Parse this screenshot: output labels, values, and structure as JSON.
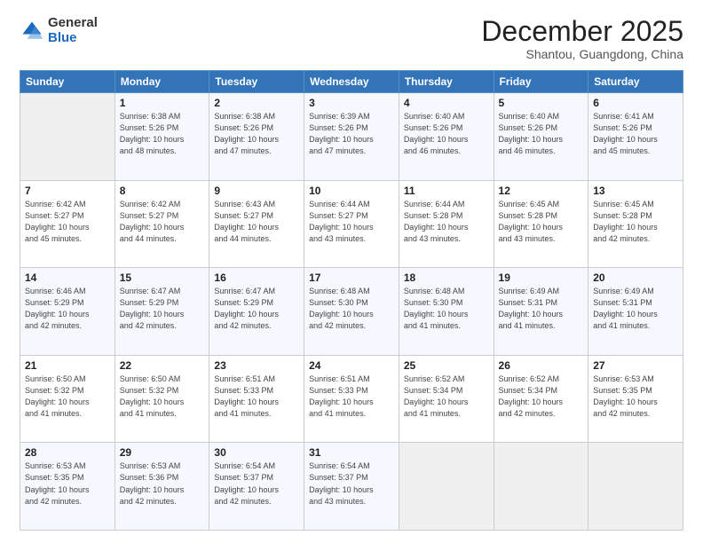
{
  "logo": {
    "general": "General",
    "blue": "Blue"
  },
  "header": {
    "month": "December 2025",
    "location": "Shantou, Guangdong, China"
  },
  "weekdays": [
    "Sunday",
    "Monday",
    "Tuesday",
    "Wednesday",
    "Thursday",
    "Friday",
    "Saturday"
  ],
  "weeks": [
    [
      {
        "day": "",
        "info": ""
      },
      {
        "day": "1",
        "info": "Sunrise: 6:38 AM\nSunset: 5:26 PM\nDaylight: 10 hours\nand 48 minutes."
      },
      {
        "day": "2",
        "info": "Sunrise: 6:38 AM\nSunset: 5:26 PM\nDaylight: 10 hours\nand 47 minutes."
      },
      {
        "day": "3",
        "info": "Sunrise: 6:39 AM\nSunset: 5:26 PM\nDaylight: 10 hours\nand 47 minutes."
      },
      {
        "day": "4",
        "info": "Sunrise: 6:40 AM\nSunset: 5:26 PM\nDaylight: 10 hours\nand 46 minutes."
      },
      {
        "day": "5",
        "info": "Sunrise: 6:40 AM\nSunset: 5:26 PM\nDaylight: 10 hours\nand 46 minutes."
      },
      {
        "day": "6",
        "info": "Sunrise: 6:41 AM\nSunset: 5:26 PM\nDaylight: 10 hours\nand 45 minutes."
      }
    ],
    [
      {
        "day": "7",
        "info": "Sunrise: 6:42 AM\nSunset: 5:27 PM\nDaylight: 10 hours\nand 45 minutes."
      },
      {
        "day": "8",
        "info": "Sunrise: 6:42 AM\nSunset: 5:27 PM\nDaylight: 10 hours\nand 44 minutes."
      },
      {
        "day": "9",
        "info": "Sunrise: 6:43 AM\nSunset: 5:27 PM\nDaylight: 10 hours\nand 44 minutes."
      },
      {
        "day": "10",
        "info": "Sunrise: 6:44 AM\nSunset: 5:27 PM\nDaylight: 10 hours\nand 43 minutes."
      },
      {
        "day": "11",
        "info": "Sunrise: 6:44 AM\nSunset: 5:28 PM\nDaylight: 10 hours\nand 43 minutes."
      },
      {
        "day": "12",
        "info": "Sunrise: 6:45 AM\nSunset: 5:28 PM\nDaylight: 10 hours\nand 43 minutes."
      },
      {
        "day": "13",
        "info": "Sunrise: 6:45 AM\nSunset: 5:28 PM\nDaylight: 10 hours\nand 42 minutes."
      }
    ],
    [
      {
        "day": "14",
        "info": "Sunrise: 6:46 AM\nSunset: 5:29 PM\nDaylight: 10 hours\nand 42 minutes."
      },
      {
        "day": "15",
        "info": "Sunrise: 6:47 AM\nSunset: 5:29 PM\nDaylight: 10 hours\nand 42 minutes."
      },
      {
        "day": "16",
        "info": "Sunrise: 6:47 AM\nSunset: 5:29 PM\nDaylight: 10 hours\nand 42 minutes."
      },
      {
        "day": "17",
        "info": "Sunrise: 6:48 AM\nSunset: 5:30 PM\nDaylight: 10 hours\nand 42 minutes."
      },
      {
        "day": "18",
        "info": "Sunrise: 6:48 AM\nSunset: 5:30 PM\nDaylight: 10 hours\nand 41 minutes."
      },
      {
        "day": "19",
        "info": "Sunrise: 6:49 AM\nSunset: 5:31 PM\nDaylight: 10 hours\nand 41 minutes."
      },
      {
        "day": "20",
        "info": "Sunrise: 6:49 AM\nSunset: 5:31 PM\nDaylight: 10 hours\nand 41 minutes."
      }
    ],
    [
      {
        "day": "21",
        "info": "Sunrise: 6:50 AM\nSunset: 5:32 PM\nDaylight: 10 hours\nand 41 minutes."
      },
      {
        "day": "22",
        "info": "Sunrise: 6:50 AM\nSunset: 5:32 PM\nDaylight: 10 hours\nand 41 minutes."
      },
      {
        "day": "23",
        "info": "Sunrise: 6:51 AM\nSunset: 5:33 PM\nDaylight: 10 hours\nand 41 minutes."
      },
      {
        "day": "24",
        "info": "Sunrise: 6:51 AM\nSunset: 5:33 PM\nDaylight: 10 hours\nand 41 minutes."
      },
      {
        "day": "25",
        "info": "Sunrise: 6:52 AM\nSunset: 5:34 PM\nDaylight: 10 hours\nand 41 minutes."
      },
      {
        "day": "26",
        "info": "Sunrise: 6:52 AM\nSunset: 5:34 PM\nDaylight: 10 hours\nand 42 minutes."
      },
      {
        "day": "27",
        "info": "Sunrise: 6:53 AM\nSunset: 5:35 PM\nDaylight: 10 hours\nand 42 minutes."
      }
    ],
    [
      {
        "day": "28",
        "info": "Sunrise: 6:53 AM\nSunset: 5:35 PM\nDaylight: 10 hours\nand 42 minutes."
      },
      {
        "day": "29",
        "info": "Sunrise: 6:53 AM\nSunset: 5:36 PM\nDaylight: 10 hours\nand 42 minutes."
      },
      {
        "day": "30",
        "info": "Sunrise: 6:54 AM\nSunset: 5:37 PM\nDaylight: 10 hours\nand 42 minutes."
      },
      {
        "day": "31",
        "info": "Sunrise: 6:54 AM\nSunset: 5:37 PM\nDaylight: 10 hours\nand 43 minutes."
      },
      {
        "day": "",
        "info": ""
      },
      {
        "day": "",
        "info": ""
      },
      {
        "day": "",
        "info": ""
      }
    ]
  ]
}
